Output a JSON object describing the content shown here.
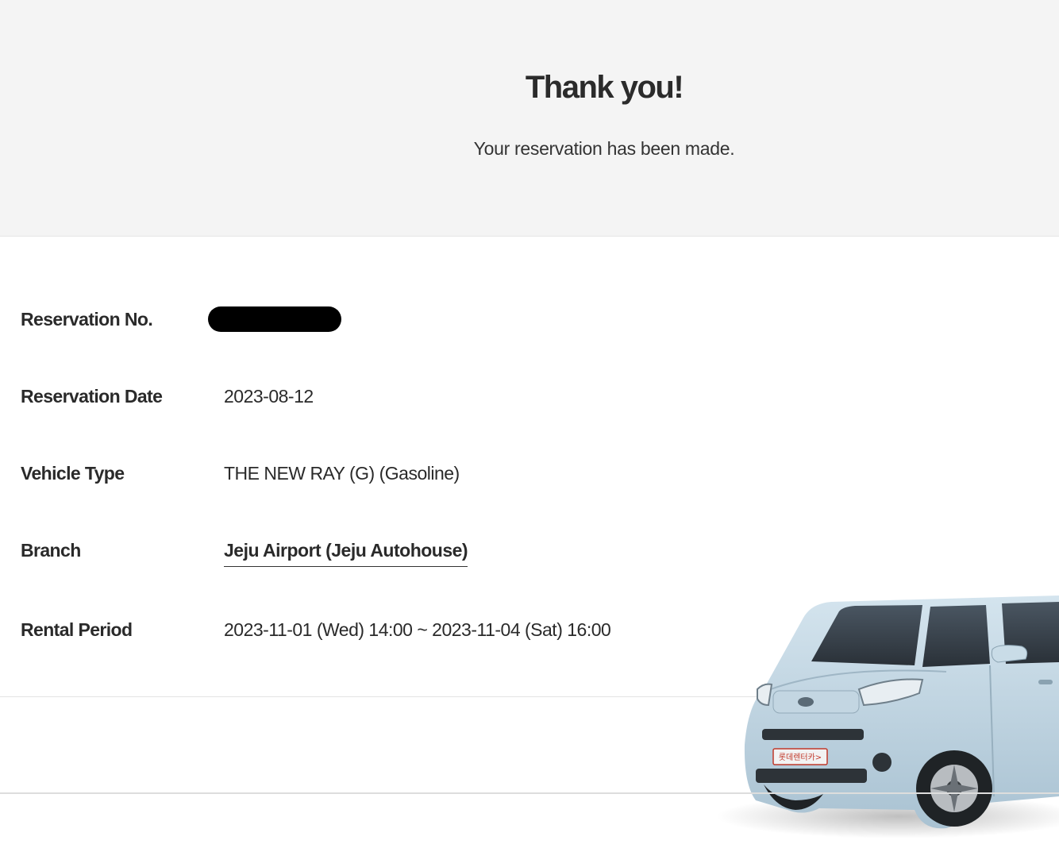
{
  "header": {
    "title": "Thank you!",
    "subtitle": "Your reservation has been made."
  },
  "details": {
    "reservation_no": {
      "label": "Reservation No.",
      "value_redacted": true
    },
    "reservation_date": {
      "label": "Reservation Date",
      "value": "2023-08-12"
    },
    "vehicle_type": {
      "label": "Vehicle Type",
      "value": "THE NEW RAY (G) (Gasoline)"
    },
    "branch": {
      "label": "Branch",
      "value": "Jeju Airport (Jeju Autohouse)"
    },
    "rental_period": {
      "label": "Rental Period",
      "value": "2023-11-01 (Wed) 14:00 ~ 2023-11-04 (Sat) 16:00"
    }
  },
  "vehicle_image": {
    "icon": "car-image",
    "body_color": "#bcd3e0",
    "plate_text": "롯데렌터카>"
  },
  "colors": {
    "hero_bg": "#f4f4f4",
    "text": "#2a2a2a"
  }
}
